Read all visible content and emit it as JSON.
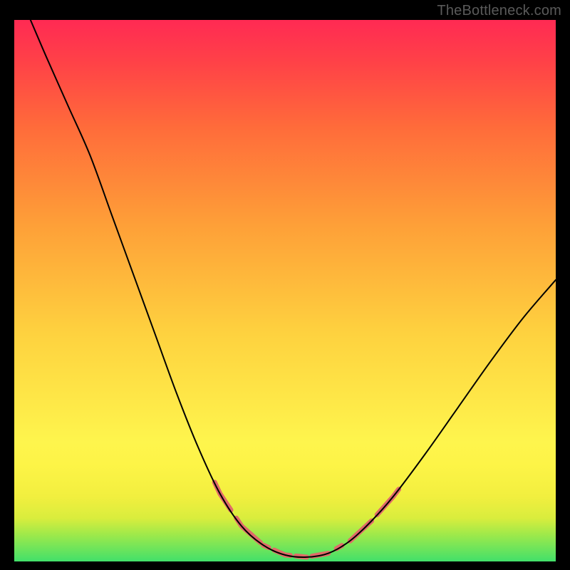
{
  "watermark": "TheBottleneck.com",
  "chart_data": {
    "type": "line",
    "title": "",
    "xlabel": "",
    "ylabel": "",
    "xlim": [
      0,
      100
    ],
    "ylim": [
      0,
      100
    ],
    "gradient_stops": [
      {
        "offset": 0.0,
        "color": "#42e06a"
      },
      {
        "offset": 0.05,
        "color": "#9fe94a"
      },
      {
        "offset": 0.08,
        "color": "#d9ed3d"
      },
      {
        "offset": 0.12,
        "color": "#f2ef3f"
      },
      {
        "offset": 0.18,
        "color": "#fdf447"
      },
      {
        "offset": 0.22,
        "color": "#fef54d"
      },
      {
        "offset": 0.42,
        "color": "#fed23f"
      },
      {
        "offset": 0.62,
        "color": "#fea038"
      },
      {
        "offset": 0.8,
        "color": "#ff6c3a"
      },
      {
        "offset": 0.92,
        "color": "#ff4247"
      },
      {
        "offset": 1.0,
        "color": "#ff2a53"
      }
    ],
    "series": [
      {
        "name": "curve",
        "stroke": "#000000",
        "stroke_width": 2,
        "points": [
          {
            "x": 3.0,
            "y": 100.0
          },
          {
            "x": 6.0,
            "y": 93.0
          },
          {
            "x": 10.0,
            "y": 84.0
          },
          {
            "x": 14.0,
            "y": 75.0
          },
          {
            "x": 18.0,
            "y": 64.0
          },
          {
            "x": 22.0,
            "y": 53.0
          },
          {
            "x": 26.0,
            "y": 42.0
          },
          {
            "x": 30.0,
            "y": 31.0
          },
          {
            "x": 34.0,
            "y": 21.0
          },
          {
            "x": 38.0,
            "y": 12.5
          },
          {
            "x": 42.0,
            "y": 6.5
          },
          {
            "x": 46.0,
            "y": 3.0
          },
          {
            "x": 50.0,
            "y": 1.2
          },
          {
            "x": 54.0,
            "y": 0.8
          },
          {
            "x": 58.0,
            "y": 1.5
          },
          {
            "x": 62.0,
            "y": 3.8
          },
          {
            "x": 66.0,
            "y": 7.5
          },
          {
            "x": 70.0,
            "y": 12.0
          },
          {
            "x": 76.0,
            "y": 20.0
          },
          {
            "x": 82.0,
            "y": 28.5
          },
          {
            "x": 88.0,
            "y": 37.0
          },
          {
            "x": 94.0,
            "y": 45.0
          },
          {
            "x": 100.0,
            "y": 52.0
          }
        ]
      }
    ],
    "highlight_segments": {
      "stroke": "#e06a68",
      "stroke_width": 7,
      "ranges_x": [
        [
          37.0,
          40.0
        ],
        [
          41.0,
          45.5
        ],
        [
          46.0,
          47.0
        ],
        [
          48.0,
          51.0
        ],
        [
          52.0,
          54.0
        ],
        [
          55.0,
          58.0
        ],
        [
          59.5,
          60.5
        ],
        [
          62.0,
          66.0
        ],
        [
          67.0,
          71.0
        ]
      ]
    }
  }
}
